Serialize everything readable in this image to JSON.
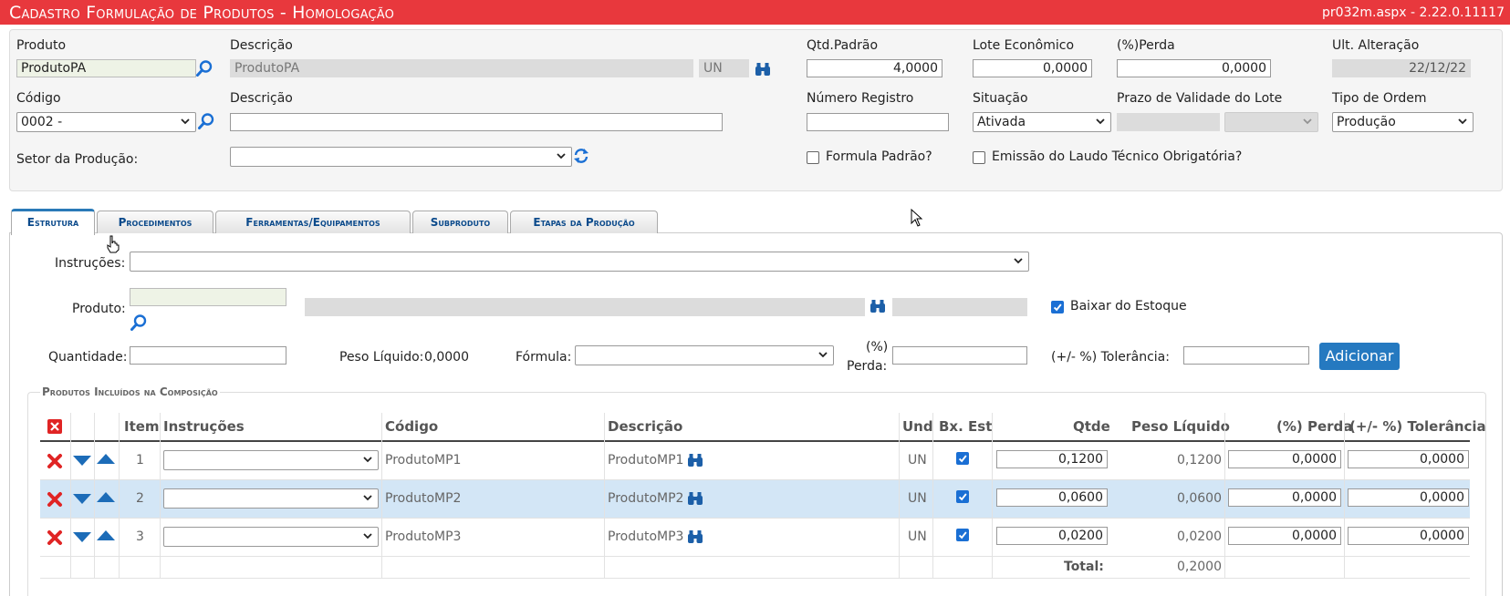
{
  "title": "Cadastro Formulação de Produtos  - Homologação",
  "version": "pr032m.aspx - 2.22.0.11117",
  "form": {
    "produto_label": "Produto",
    "produto_value": "ProdutoPA",
    "descricao_label": "Descrição",
    "descricao_value": "ProdutoPA",
    "unit_value": "UN",
    "qtd_padrao_label": "Qtd.Padrão",
    "qtd_padrao_value": "4,0000",
    "lote_economico_label": "Lote Econômico",
    "lote_economico_value": "0,0000",
    "perda_label": "(%)Perda",
    "perda_value": "0,0000",
    "ult_alteracao_label": "Ult. Alteração",
    "ult_alteracao_value": "22/12/22",
    "codigo_label": "Código",
    "codigo_value": "0002 -",
    "descricao2_label": "Descrição",
    "descricao2_value": "",
    "numero_registro_label": "Número Registro",
    "numero_registro_value": "",
    "situacao_label": "Situação",
    "situacao_value": "Ativada",
    "prazo_label": "Prazo de Validade do Lote",
    "tipo_ordem_label": "Tipo de Ordem",
    "tipo_ordem_value": "Produção",
    "setor_label": "Setor da Produção:",
    "setor_value": "",
    "formula_padrao_label": "Formula Padrão?",
    "formula_padrao_checked": false,
    "emissao_label": "Emissão do Laudo Técnico Obrigatória?",
    "emissao_checked": false
  },
  "tabs": [
    {
      "label": "Estrutura",
      "active": true
    },
    {
      "label": "Procedimentos",
      "active": false
    },
    {
      "label": "Ferramentas/Equipamentos",
      "active": false
    },
    {
      "label": "Subproduto",
      "active": false
    },
    {
      "label": "Etapas da Produção",
      "active": false
    }
  ],
  "estrutura": {
    "instrucoes_label": "Instruções:",
    "produto_label": "Produto:",
    "baixar_label": "Baixar do Estoque",
    "baixar_checked": true,
    "quantidade_label": "Quantidade:",
    "peso_liquido_label": "Peso Líquido:",
    "peso_liquido_value": "0,0000",
    "formula_label": "Fórmula:",
    "perda_label_1": "(%)",
    "perda_label_2": "Perda:",
    "tolerancia_label": "(+/- %) Tolerância:",
    "adicionar_label": "Adicionar"
  },
  "composicao": {
    "legend": "Produtos Incluídos na Composição",
    "headers": [
      "Item",
      "Instruções",
      "Código",
      "Descrição",
      "Und",
      "Bx. Est",
      "Qtde",
      "Peso Líquido",
      "(%) Perda",
      "(+/- %) Tolerância"
    ],
    "rows": [
      {
        "item": "1",
        "codigo": "ProdutoMP1",
        "descricao": "ProdutoMP1",
        "und": "UN",
        "bx_est": true,
        "qtde": "0,1200",
        "peso": "0,1200",
        "perda": "0,0000",
        "tolerancia": "0,0000"
      },
      {
        "item": "2",
        "codigo": "ProdutoMP2",
        "descricao": "ProdutoMP2",
        "und": "UN",
        "bx_est": true,
        "qtde": "0,0600",
        "peso": "0,0600",
        "perda": "0,0000",
        "tolerancia": "0,0000"
      },
      {
        "item": "3",
        "codigo": "ProdutoMP3",
        "descricao": "ProdutoMP3",
        "und": "UN",
        "bx_est": true,
        "qtde": "0,0200",
        "peso": "0,0200",
        "perda": "0,0000",
        "tolerancia": "0,0000"
      }
    ],
    "total_label": "Total:",
    "total_value": "0,2000"
  },
  "colors": {
    "titlebar": "#e8383d",
    "accent": "#2579c0",
    "row_highlight": "#d3e6f6",
    "delete": "#e02424"
  }
}
